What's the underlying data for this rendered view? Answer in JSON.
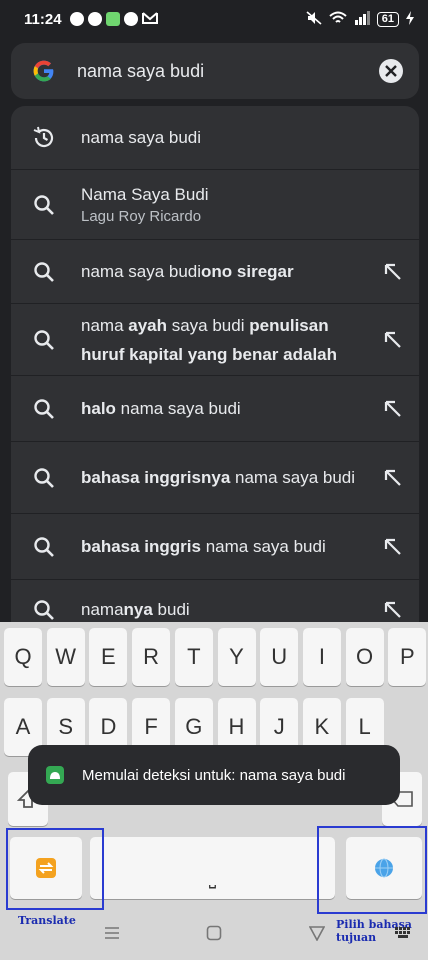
{
  "status_bar": {
    "time": "11:24",
    "battery": "61"
  },
  "search": {
    "query": "nama saya budi"
  },
  "suggestions": [
    {
      "type": "history",
      "parts": [
        {
          "t": "nama saya budi",
          "b": false
        }
      ]
    },
    {
      "type": "entity",
      "title": "Nama Saya Budi",
      "subtitle": "Lagu Roy Ricardo"
    },
    {
      "type": "search",
      "parts": [
        {
          "t": "nama saya budi",
          "b": false
        },
        {
          "t": "ono siregar",
          "b": true
        }
      ]
    },
    {
      "type": "search",
      "parts": [
        {
          "t": "nama ",
          "b": false
        },
        {
          "t": "ayah",
          "b": true
        },
        {
          "t": " saya budi ",
          "b": false
        },
        {
          "t": "penulisan huruf kapital yang benar adalah",
          "b": true
        }
      ]
    },
    {
      "type": "search",
      "parts": [
        {
          "t": "halo",
          "b": true
        },
        {
          "t": " nama saya budi",
          "b": false
        }
      ]
    },
    {
      "type": "search",
      "parts": [
        {
          "t": "bahasa inggrisnya",
          "b": true
        },
        {
          "t": " nama saya budi",
          "b": false
        }
      ]
    },
    {
      "type": "search",
      "parts": [
        {
          "t": "bahasa inggris",
          "b": true
        },
        {
          "t": " nama saya budi",
          "b": false
        }
      ]
    },
    {
      "type": "search",
      "parts": [
        {
          "t": "nama",
          "b": false
        },
        {
          "t": "nya",
          "b": true
        },
        {
          "t": " budi",
          "b": false
        }
      ]
    }
  ],
  "keyboard": {
    "row1": [
      "Q",
      "W",
      "E",
      "R",
      "T",
      "Y",
      "U",
      "I",
      "O",
      "P"
    ],
    "row2": [
      "A",
      "S",
      "D",
      "F",
      "G",
      "H",
      "J",
      "K",
      "L"
    ],
    "space_label": "⎵"
  },
  "toast": {
    "message": "Memulai deteksi untuk: nama saya budi"
  },
  "annotations": {
    "translate": "Translate",
    "pilih": "Pilih bahasa tujuan"
  },
  "colors": {
    "background": "#202124",
    "surface": "#303134",
    "annotation": "#2a3bd1"
  }
}
